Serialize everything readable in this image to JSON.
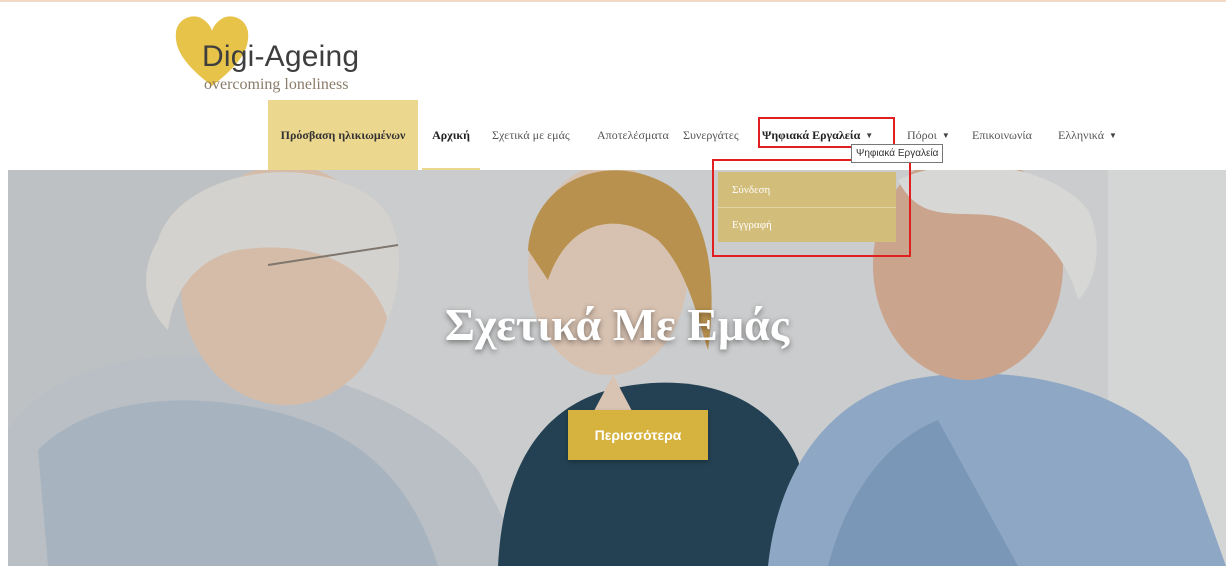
{
  "logo": {
    "title": "Digi-Ageing",
    "tagline": "overcoming loneliness",
    "heart_color": "#e7c34a"
  },
  "nav": {
    "elderly_access": "Πρόσβαση ηλικιωμένων",
    "home": "Αρχική",
    "about": "Σχετικά με εμάς",
    "results": "Αποτελέσματα",
    "partners": "Συνεργάτες",
    "digital_tools": "Ψηφιακά Εργαλεία",
    "resources": "Πόροι",
    "contact": "Επικοινωνία",
    "language": "Ελληνικά",
    "active": "home"
  },
  "tooltip": "Ψηφιακά Εργαλεία",
  "dropdown": {
    "items": [
      "Σύνδεση",
      "Εγγραφή"
    ]
  },
  "hero": {
    "title": "Σχετικά Με Εμάς",
    "button": "Περισσότερα"
  },
  "colors": {
    "accent": "#d6b23f",
    "nav_highlight": "#ecd78f",
    "dropdown_bg": "#d3bd7a",
    "annotation_red": "#e02020"
  }
}
